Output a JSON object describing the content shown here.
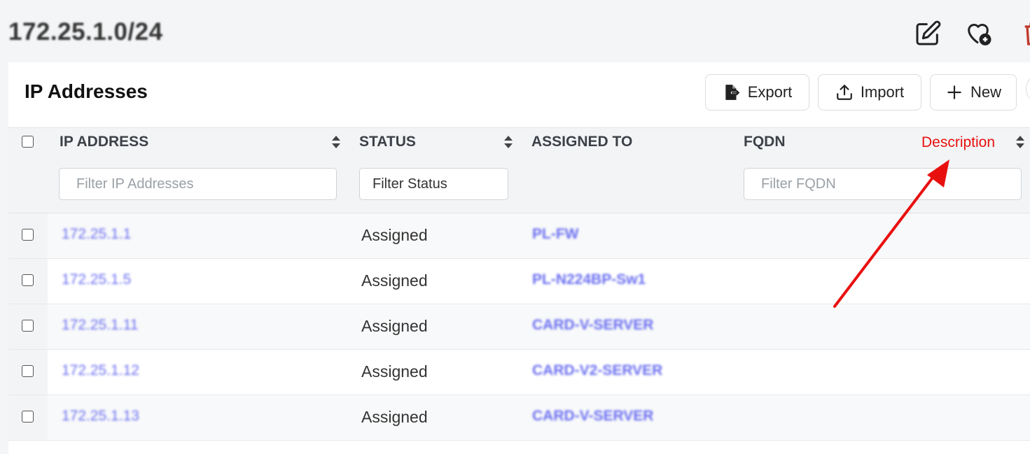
{
  "prefix": {
    "title": "172.25.1.0/24"
  },
  "top_actions": [
    "edit-icon",
    "favorite-add-icon",
    "delete-icon"
  ],
  "section": {
    "title": "IP Addresses",
    "buttons": {
      "export": "Export",
      "import": "Import",
      "new": "New"
    }
  },
  "table": {
    "columns": {
      "ip": "IP ADDRESS",
      "status": "STATUS",
      "assigned": "ASSIGNED TO",
      "fqdn": "FQDN"
    },
    "filters": {
      "ip": "Filter IP Addresses",
      "status": "Filter Status",
      "fqdn": "Filter FQDN"
    },
    "rows": [
      {
        "ip": "172.25.1.1",
        "status": "Assigned",
        "assigned": "PL-FW"
      },
      {
        "ip": "172.25.1.5",
        "status": "Assigned",
        "assigned": "PL-N224BP-Sw1"
      },
      {
        "ip": "172.25.1.11",
        "status": "Assigned",
        "assigned": "CARD-V-SERVER"
      },
      {
        "ip": "172.25.1.12",
        "status": "Assigned",
        "assigned": "CARD-V2-SERVER"
      },
      {
        "ip": "172.25.1.13",
        "status": "Assigned",
        "assigned": "CARD-V-SERVER"
      }
    ]
  },
  "annotation": {
    "label": "Description",
    "color": "#e8100f"
  },
  "colors": {
    "link": "#6b6ff0",
    "delete": "#c0392b"
  }
}
